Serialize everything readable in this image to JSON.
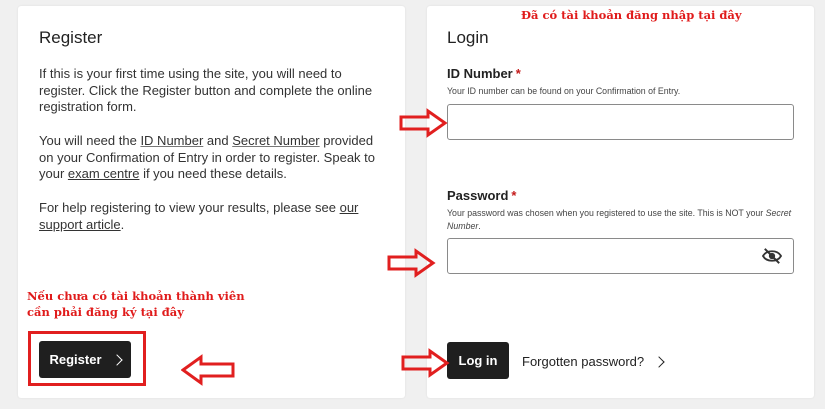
{
  "register": {
    "title": "Register",
    "p1": "If this is your first time using the site, you will need to register. Click the Register button and complete the online registration form.",
    "p2_a": "You will need the ",
    "p2_id": "ID Number",
    "p2_b": " and ",
    "p2_secret": "Secret Number",
    "p2_c": " provided on your Confirmation of Entry in order to register. Speak to your ",
    "p2_centre": "exam centre",
    "p2_d": " if you need these details.",
    "p3_a": "For help registering to view your results, please see ",
    "p3_link": "our support article",
    "p3_b": ".",
    "button_label": "Register"
  },
  "login": {
    "title": "Login",
    "id_label": "ID Number",
    "id_required": "*",
    "id_hint": "Your ID number can be found on your Confirmation of Entry.",
    "id_value": "",
    "password_label": "Password",
    "password_required": "*",
    "password_hint_a": "Your password was chosen when you registered to use the site. This is NOT your ",
    "password_hint_secret": "Secret Number",
    "password_hint_b": ".",
    "password_value": "",
    "login_label": "Log in",
    "forgot_label": "Forgotten password?"
  },
  "annotations": {
    "top": "Đã có tài khoản đăng nhập tại đây",
    "left": "Nếu chưa có tài khoản thành viên cần phải đăng ký tại đây",
    "color": "#e01b1b"
  },
  "icons": {
    "eye": "eye-slash-icon",
    "chevron": "chevron-right-icon",
    "arrow": "red-outline-arrow-icon"
  },
  "colors": {
    "button_bg": "#1f1f1f",
    "required": "#c41a1a",
    "page_bg": "#f0f0f0"
  }
}
